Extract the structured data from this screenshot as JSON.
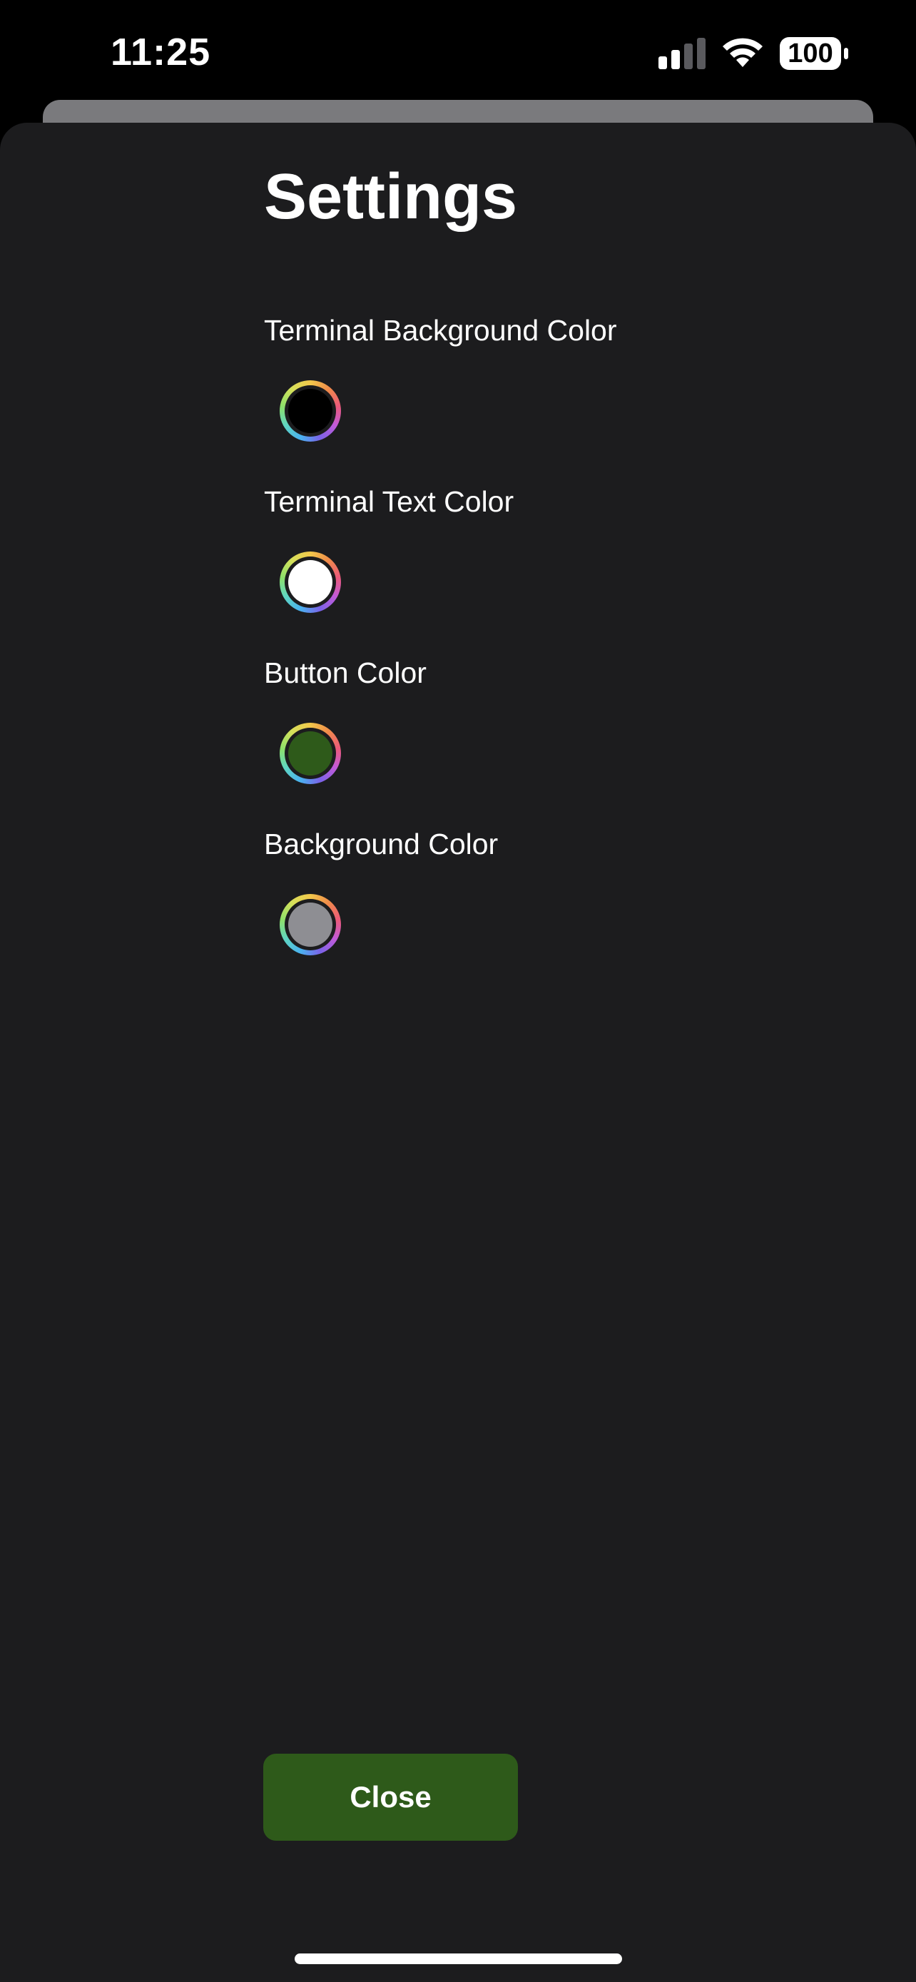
{
  "status_bar": {
    "time": "11:25",
    "battery_level": "100",
    "icons": [
      "signal-icon",
      "wifi-icon",
      "battery-icon"
    ]
  },
  "settings": {
    "title": "Settings",
    "items": [
      {
        "label": "Terminal Background Color",
        "color": "#000000"
      },
      {
        "label": "Terminal Text Color",
        "color": "#ffffff"
      },
      {
        "label": "Button Color",
        "color": "#2e5a1a"
      },
      {
        "label": "Background Color",
        "color": "#8e8e93"
      }
    ],
    "close_label": "Close",
    "close_color": "#2e5a1a"
  },
  "colors": {
    "sheet_background": "#1c1c1e",
    "behind_sheet": "#7a7a7d"
  }
}
